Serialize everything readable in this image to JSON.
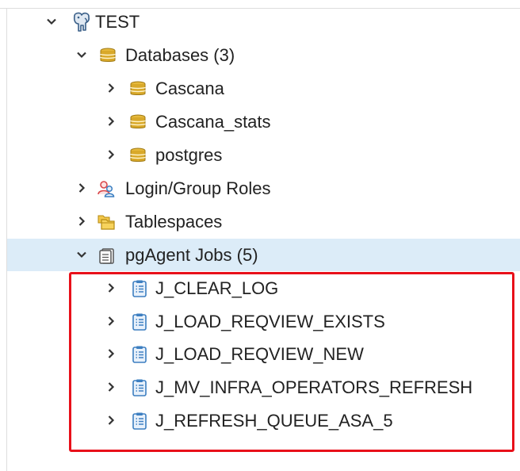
{
  "tree": {
    "server": {
      "label": "TEST",
      "expanded": true,
      "icon": "elephant-icon"
    },
    "databases": {
      "label": "Databases (3)",
      "expanded": true,
      "icon": "database-icon",
      "items": [
        {
          "label": "Cascana",
          "icon": "database-icon"
        },
        {
          "label": "Cascana_stats",
          "icon": "database-icon"
        },
        {
          "label": "postgres",
          "icon": "database-icon"
        }
      ]
    },
    "login_roles": {
      "label": "Login/Group Roles",
      "icon": "users-icon"
    },
    "tablespaces": {
      "label": "Tablespaces",
      "icon": "folders-icon"
    },
    "pgagent": {
      "label": "pgAgent Jobs (5)",
      "expanded": true,
      "selected": true,
      "icon": "clipboard-icon",
      "jobs": [
        {
          "label": "J_CLEAR_LOG",
          "icon": "job-icon"
        },
        {
          "label": "J_LOAD_REQVIEW_EXISTS",
          "icon": "job-icon"
        },
        {
          "label": "J_LOAD_REQVIEW_NEW",
          "icon": "job-icon"
        },
        {
          "label": "J_MV_INFRA_OPERATORS_REFRESH",
          "icon": "job-icon"
        },
        {
          "label": "J_REFRESH_QUEUE_ASA_5",
          "icon": "job-icon"
        }
      ]
    }
  },
  "colors": {
    "selected_row": "#dcecf8",
    "highlight_border": "#e8101a",
    "database_gold": "#d9a92a",
    "job_blue": "#3d7fc1"
  }
}
